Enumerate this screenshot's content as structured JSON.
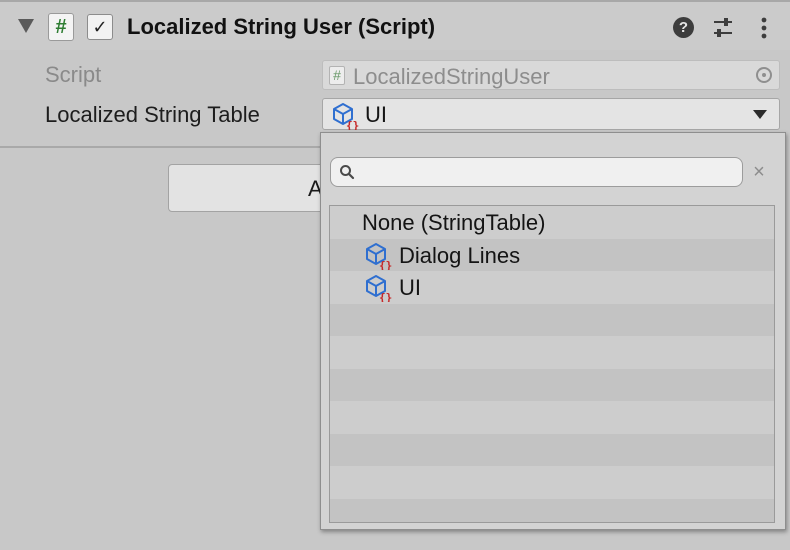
{
  "component": {
    "title": "Localized String User (Script)",
    "enabled_check": "✓",
    "script_glyph": "#",
    "help_glyph": "?"
  },
  "properties": {
    "script_label": "Script",
    "script_value": "LocalizedStringUser",
    "table_label": "Localized String Table",
    "table_value": "UI"
  },
  "button": {
    "visible_label": "A"
  },
  "popup": {
    "search_value": "",
    "clear_glyph": "×",
    "items": [
      {
        "label": "None (StringTable)",
        "icon": "none"
      },
      {
        "label": "Dialog Lines",
        "icon": "string-table-icon"
      },
      {
        "label": "UI",
        "icon": "string-table-icon"
      }
    ]
  },
  "colors": {
    "table_icon_blue": "#2f6fd0",
    "table_icon_red": "#c62828",
    "script_green": "#2e7d32"
  }
}
